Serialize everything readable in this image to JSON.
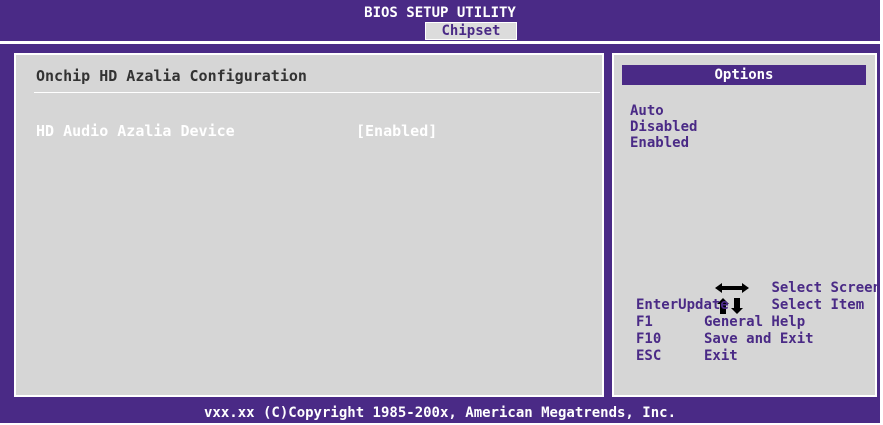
{
  "header": {
    "title": "BIOS SETUP UTILITY",
    "active_tab": "Chipset"
  },
  "main": {
    "page_title": "Onchip HD Azalia Configuration",
    "settings": [
      {
        "label": "HD Audio Azalia Device",
        "value": "[Enabled]"
      }
    ]
  },
  "options_panel": {
    "header": "Options",
    "items": [
      "Auto",
      "Disabled",
      "Enabled"
    ]
  },
  "help": {
    "left_right_icon": "left-right-arrow-icon",
    "up_down_icon": "up-down-arrow-icon",
    "select_screen": "Select Screen",
    "select_item": "Select Item",
    "enter_key": "Enter",
    "enter_action": "Update",
    "f1_key": "F1",
    "f1_action": "General Help",
    "f10_key": "F10",
    "f10_action": "Save and Exit",
    "esc_key": "ESC",
    "esc_action": "Exit"
  },
  "footer": {
    "copyright": "vxx.xx (C)Copyright 1985-200x, American Megatrends, Inc."
  },
  "colors": {
    "background": "#4a2a86",
    "panel": "#d6d6d6",
    "highlight_text": "#ffffff",
    "option_text": "#4a2a86"
  }
}
